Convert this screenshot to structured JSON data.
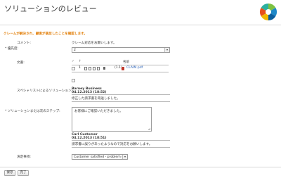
{
  "page": {
    "title": "ソリューションのレビュー",
    "alert": "クレームが解決され、顧客が満足したことを確認します。"
  },
  "form": {
    "comment_label": "コメント:",
    "comment_value": "クレーム対応をお願いします。",
    "priority_label": "優先度:",
    "priority_value": "2",
    "documents_label": "文書:",
    "documents": {
      "header_sort": "↑",
      "header_name": "名前",
      "rows": [
        {
          "index": "1",
          "size": "(1.1)",
          "filename": "CLAIM.pdf"
        }
      ]
    },
    "specialist_label": "スペシャリストによるソリューション:",
    "specialist": {
      "author": "Barney Business",
      "timestamp": "04.12.2013 (18:52)",
      "text": "修正した請求書を再送しました。"
    },
    "solution_label": "ソリューションまたは次のステップ:",
    "solution_input": "お客様にご確認いただきました。",
    "customer": {
      "author": "Carl Customer",
      "timestamp": "04.12.2013 (18:51)",
      "text": "請求書に誤りがあったようなので対応をお願いします。"
    },
    "decision_label": "決定事項:",
    "decision_value": "Customer satisfied - problem so"
  },
  "buttons": {
    "save": "保存",
    "complete": "完了"
  },
  "colors": {
    "alert": "#e07a00",
    "link": "#2a62b8"
  },
  "icons": [
    "logo-icon",
    "checkbox-icon",
    "attachment-icon",
    "pdf-icon",
    "lock-icon"
  ]
}
